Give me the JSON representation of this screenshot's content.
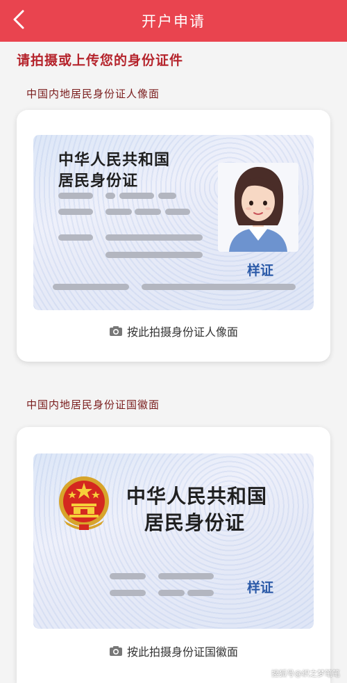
{
  "header": {
    "title": "开户申请",
    "back_icon": "chevron-left-icon"
  },
  "page_title": "请拍摄或上传您的身份证件",
  "front": {
    "section_label": "中国内地居民身份证人像面",
    "card_title_line1": "中华人民共和国",
    "card_title_line2": "居民身份证",
    "sample_label": "样证",
    "action_label": "按此拍摄身份证人像面",
    "action_icon": "camera-icon"
  },
  "back": {
    "section_label": "中国内地居民身份证国徽面",
    "card_title_line1": "中华人民共和国",
    "card_title_line2": "居民身份证",
    "sample_label": "样证",
    "action_label": "按此拍摄身份证国徽面",
    "action_icon": "camera-icon"
  },
  "watermark": "搜狐号@织之梦笔笔",
  "colors": {
    "header": "#e9444f",
    "title_red": "#b5242c",
    "sample_blue": "#2b5aa8"
  }
}
